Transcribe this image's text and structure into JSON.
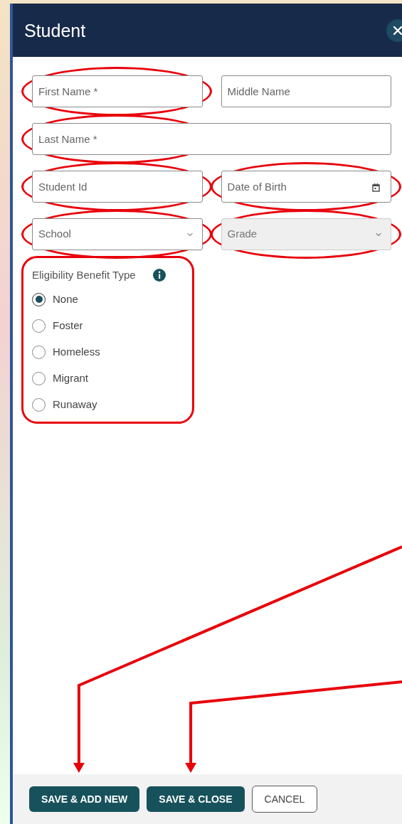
{
  "dialog": {
    "title": "Student"
  },
  "rows": [
    [
      {
        "kind": "text",
        "placeholder": "First Name *",
        "circled": true,
        "disabled": false
      },
      {
        "kind": "text",
        "placeholder": "Middle Name",
        "circled": false,
        "disabled": false
      }
    ],
    [
      {
        "kind": "text",
        "placeholder": "Last Name *",
        "circled": true,
        "disabled": false
      }
    ],
    [
      {
        "kind": "text",
        "placeholder": "Student Id",
        "circled": true,
        "disabled": false
      },
      {
        "kind": "date",
        "placeholder": "Date of Birth",
        "circled": true,
        "disabled": false
      }
    ],
    [
      {
        "kind": "select",
        "placeholder": "School",
        "circled": true,
        "disabled": false
      },
      {
        "kind": "select",
        "placeholder": "Grade",
        "circled": true,
        "disabled": true
      }
    ]
  ],
  "eligibility": {
    "label": "Eligibility Benefit Type",
    "circled": true,
    "options": [
      {
        "label": "None",
        "selected": true
      },
      {
        "label": "Foster",
        "selected": false
      },
      {
        "label": "Homeless",
        "selected": false
      },
      {
        "label": "Migrant",
        "selected": false
      },
      {
        "label": "Runaway",
        "selected": false
      }
    ]
  },
  "buttons": [
    {
      "label": "SAVE & ADD NEW",
      "kind": "primary",
      "arrowed": true
    },
    {
      "label": "SAVE & CLOSE",
      "kind": "primary",
      "arrowed": true
    },
    {
      "label": "CANCEL",
      "kind": "outline",
      "arrowed": false
    }
  ]
}
